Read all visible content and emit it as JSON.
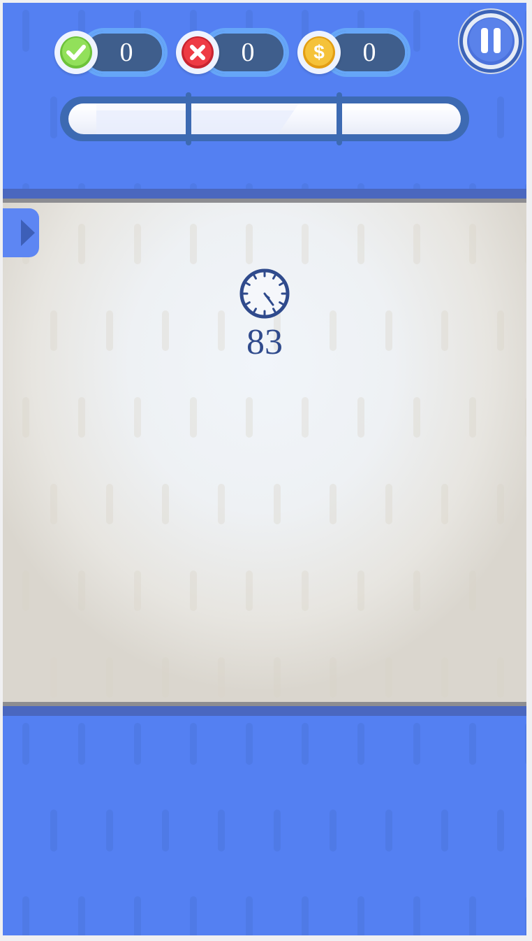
{
  "hud": {
    "correct": {
      "icon": "check-icon",
      "value": "0",
      "color": "#86d64a"
    },
    "wrong": {
      "icon": "x-icon",
      "value": "0",
      "color": "#e0363e"
    },
    "coins": {
      "icon": "dollar-coin-icon",
      "value": "0",
      "color": "#f2b327"
    },
    "pause": {
      "icon": "pause-icon"
    }
  },
  "progress": {
    "fill_fraction": 0
  },
  "board": {
    "timer": {
      "icon": "clock-icon",
      "value": "83"
    },
    "side_tab": {
      "icon": "chevron-right-icon"
    }
  },
  "colors": {
    "background_blue": "#5480f2",
    "dark_blue": "#3d6ab2",
    "timer_text": "#2f4a8c",
    "panel_light": "#eef1f4"
  }
}
